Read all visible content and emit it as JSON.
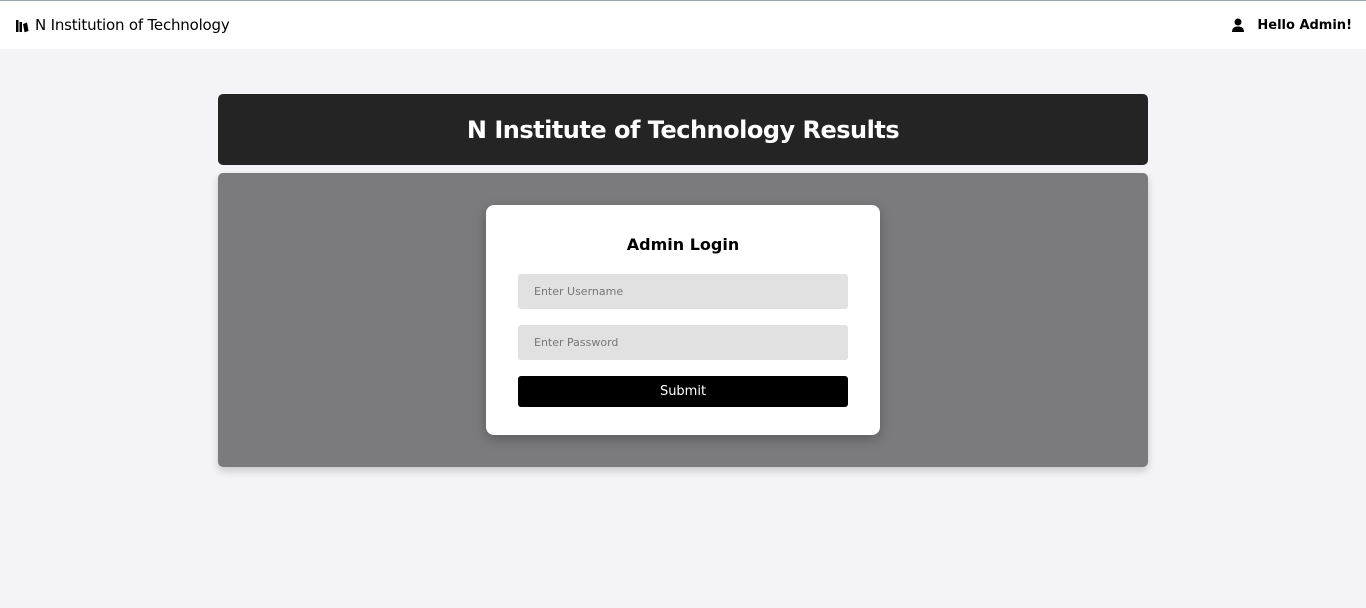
{
  "header": {
    "brand_icon": "library-books-icon",
    "brand_name": "N Institution of Technology",
    "user_icon": "person-icon",
    "greeting": "Hello Admin!"
  },
  "banner": {
    "title": "N Institute of Technology Results"
  },
  "login": {
    "title": "Admin Login",
    "username_placeholder": "Enter Username",
    "username_value": "",
    "password_placeholder": "Enter Password",
    "password_value": "",
    "submit_label": "Submit"
  },
  "colors": {
    "page_background": "#f4f4f8",
    "banner_background": "#242424",
    "panel_background": "#7b7b7d",
    "card_background": "#ffffff",
    "input_background": "#e1e1e1",
    "button_background": "#000000"
  }
}
